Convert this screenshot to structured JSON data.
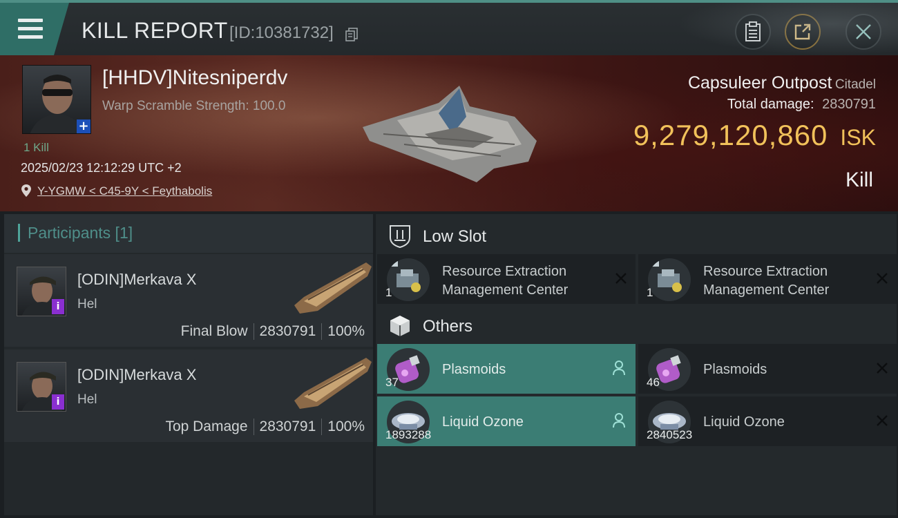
{
  "header": {
    "title": "KILL REPORT",
    "report_id": "[ID:10381732]"
  },
  "victim": {
    "pilot_name": "[HHDV]Nitesniperdv",
    "warp_scramble": "Warp Scramble Strength: 100.0",
    "kills": "1 Kill",
    "datetime": "2025/02/23 12:12:29 UTC +2",
    "location": "Y-YGMW < C45-9Y < Feythabolis",
    "ship_name": "Capsuleer Outpost",
    "ship_class": "Citadel",
    "total_damage_label": "Total damage:",
    "total_damage_value": "2830791",
    "isk_amount": "9,279,120,860",
    "isk_unit": "ISK",
    "result": "Kill"
  },
  "participants": {
    "label": "Participants [1]",
    "items": [
      {
        "name": "[ODIN]Merkava X",
        "ship": "Hel",
        "role": "Final Blow",
        "damage": "2830791",
        "percent": "100%"
      },
      {
        "name": "[ODIN]Merkava X",
        "ship": "Hel",
        "role": "Top Damage",
        "damage": "2830791",
        "percent": "100%"
      }
    ]
  },
  "low_slot": {
    "label": "Low Slot",
    "items": [
      {
        "line1": "Resource Extraction",
        "line2": "Management Center",
        "qty": "1",
        "status": "destroyed"
      },
      {
        "line1": "Resource Extraction",
        "line2": "Management Center",
        "qty": "1",
        "status": "destroyed"
      }
    ]
  },
  "others": {
    "label": "Others",
    "items": [
      {
        "name": "Plasmoids",
        "qty": "37",
        "status": "dropped"
      },
      {
        "name": "Plasmoids",
        "qty": "46",
        "status": "destroyed"
      },
      {
        "name": "Liquid Ozone",
        "qty": "1893288",
        "status": "dropped"
      },
      {
        "name": "Liquid Ozone",
        "qty": "2840523",
        "status": "destroyed"
      }
    ]
  },
  "colors": {
    "accent": "#3b7d74",
    "isk": "#f1c15a",
    "banner": "#4a1f1a"
  }
}
